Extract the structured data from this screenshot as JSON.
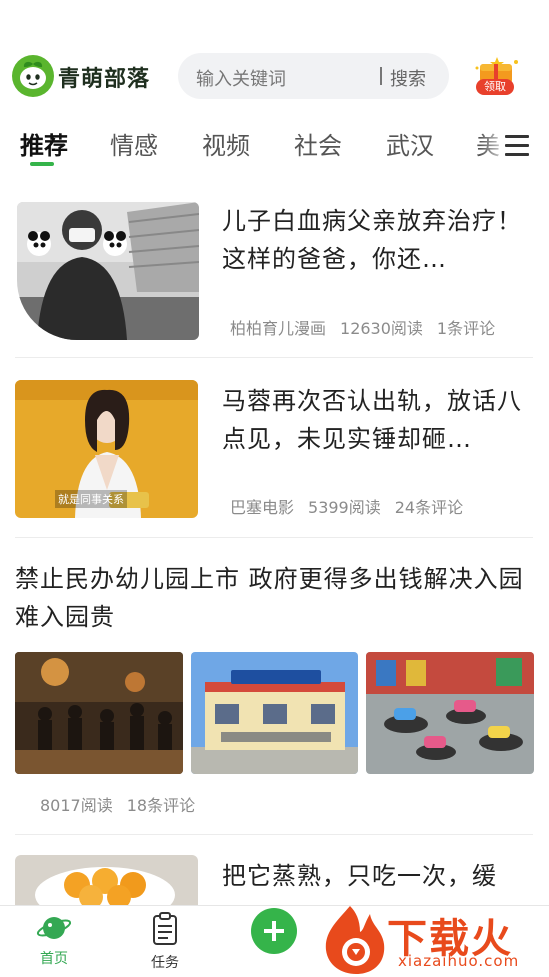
{
  "app": {
    "name": "青萌部落"
  },
  "search": {
    "placeholder": "输入关键词",
    "button": "搜索"
  },
  "reward": {
    "label": "领取"
  },
  "tabs": [
    {
      "label": "推荐",
      "active": true
    },
    {
      "label": "情感"
    },
    {
      "label": "视频"
    },
    {
      "label": "社会"
    },
    {
      "label": "武汉"
    },
    {
      "label": "美"
    }
  ],
  "feed": [
    {
      "title": "儿子白血病父亲放弃治疗！这样的爸爸，你还…",
      "source": "柏柏育儿漫画",
      "reads": "12630阅读",
      "comments": "1条评论"
    },
    {
      "title": "马蓉再次否认出轨，放话八点见，未见实锤却砸…",
      "source": "巴塞电影",
      "reads": "5399阅读",
      "comments": "24条评论",
      "thumb_caption": "就是同事关系"
    },
    {
      "title": "禁止民办幼儿园上市 政府更得多出钱解决入园难入园贵",
      "reads": "8017阅读",
      "comments": "18条评论"
    },
    {
      "title": "把它蒸熟，只吃一次，缓"
    }
  ],
  "bottom_nav": [
    {
      "label": "首页",
      "icon": "planet-icon",
      "active": true
    },
    {
      "label": "任务",
      "icon": "clipboard-icon"
    },
    {
      "label": "",
      "icon": "plus-icon"
    }
  ],
  "watermark": {
    "text": "下载火",
    "sub": "xiazaihuo.com"
  },
  "colors": {
    "accent": "#35b44a",
    "watermark": "#e84a1c"
  }
}
